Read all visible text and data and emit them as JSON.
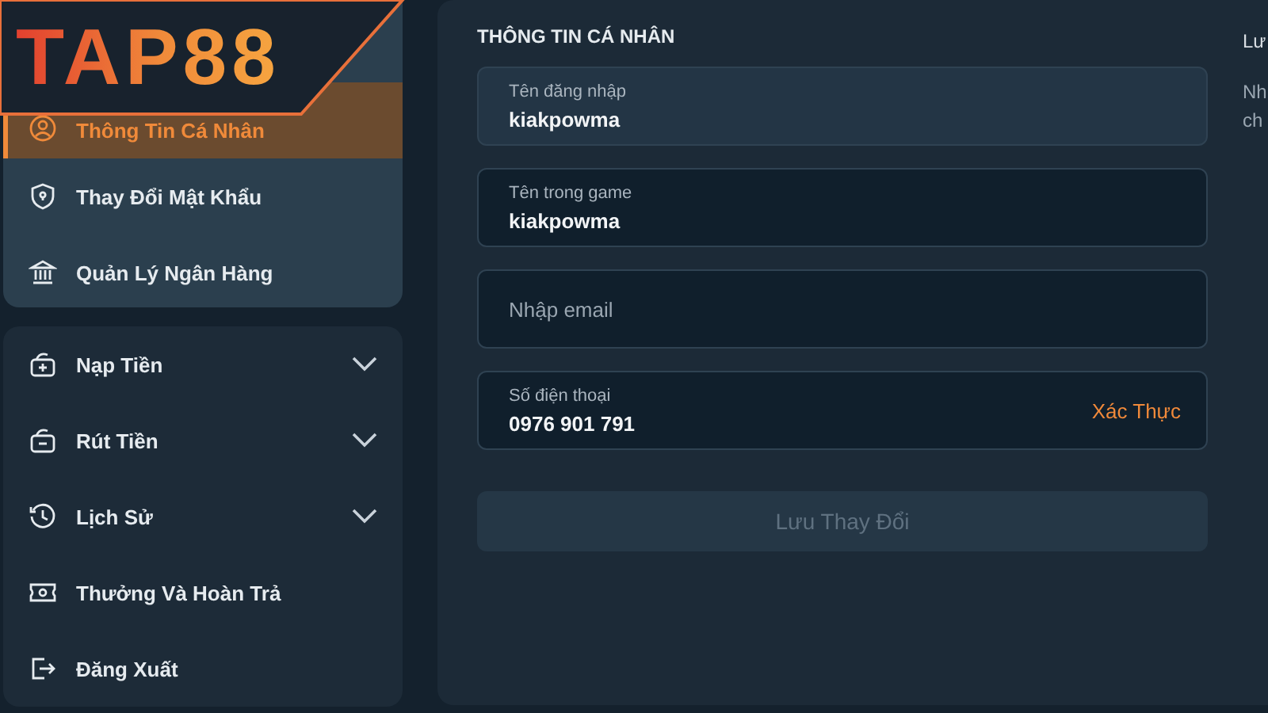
{
  "logo": {
    "text": "TAP88"
  },
  "account_menu": [
    {
      "label": "Thông Tin Cá Nhân",
      "selected": true
    },
    {
      "label": "Thay Đổi Mật Khẩu",
      "selected": false
    },
    {
      "label": "Quản Lý Ngân Hàng",
      "selected": false
    }
  ],
  "wallet_menu": [
    {
      "label": "Nạp Tiền",
      "kind": "dropdown"
    },
    {
      "label": "Rút Tiền",
      "kind": "dropdown"
    },
    {
      "label": "Lịch Sử",
      "kind": "dropdown"
    },
    {
      "label": "Thưởng Và Hoàn Trả",
      "kind": "link"
    },
    {
      "label": "Đăng Xuất",
      "kind": "link"
    }
  ],
  "form": {
    "title": "THÔNG TIN CÁ NHÂN",
    "fields": [
      {
        "kind": "filled",
        "label": "Tên đăng nhập",
        "value": "kiakpowma",
        "disabled": true
      },
      {
        "kind": "filled",
        "label": "Tên trong game",
        "value": "kiakpowma",
        "disabled": false
      },
      {
        "kind": "empty",
        "placeholder": "Nhập email",
        "disabled": false
      },
      {
        "kind": "filled",
        "label": "Số điện thoại",
        "value": "0976 901 791",
        "action": "Xác Thực",
        "disabled": false
      }
    ],
    "save_button": {
      "label": "Lưu Thay Đổi",
      "disabled": true
    }
  },
  "side_note": {
    "title": "Lư",
    "lines": [
      "Nh",
      "ch"
    ]
  }
}
